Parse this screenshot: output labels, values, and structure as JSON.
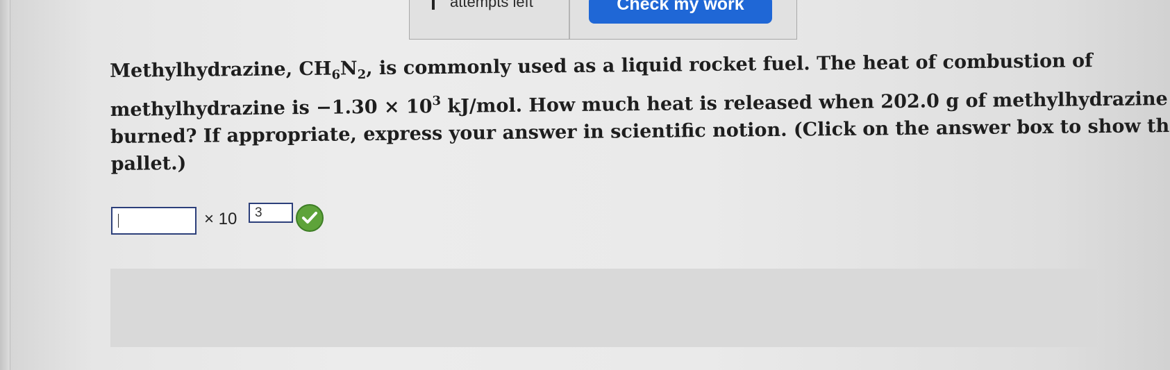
{
  "toolbar": {
    "attempts_label": "attempts left",
    "check_button_label": "Check my work"
  },
  "question": {
    "line1_a": "Methylhydrazine, CH",
    "line1_sub6": "6",
    "line1_n": "N",
    "line1_sub2": "2",
    "line1_b": ", is commonly used as a liquid rocket fuel. The heat of combustion of",
    "line2_a": "methylhydrazine is −1.30 × 10",
    "line2_sup": "3",
    "line2_b": " kJ/mol. How much heat is released when 202.0 g of methylhydrazine is",
    "line3": "burned? If appropriate, express your answer in scientific notion. (Click on the answer box to show the",
    "line4": "pallet.)"
  },
  "answer": {
    "mantissa_value": "",
    "times_ten": "× 10",
    "exponent_value": "3",
    "status_icon": "check-circle-icon",
    "status_color": "#5ea33a"
  },
  "colors": {
    "accent": "#1f67d6",
    "input_border": "#2c3f7a"
  }
}
